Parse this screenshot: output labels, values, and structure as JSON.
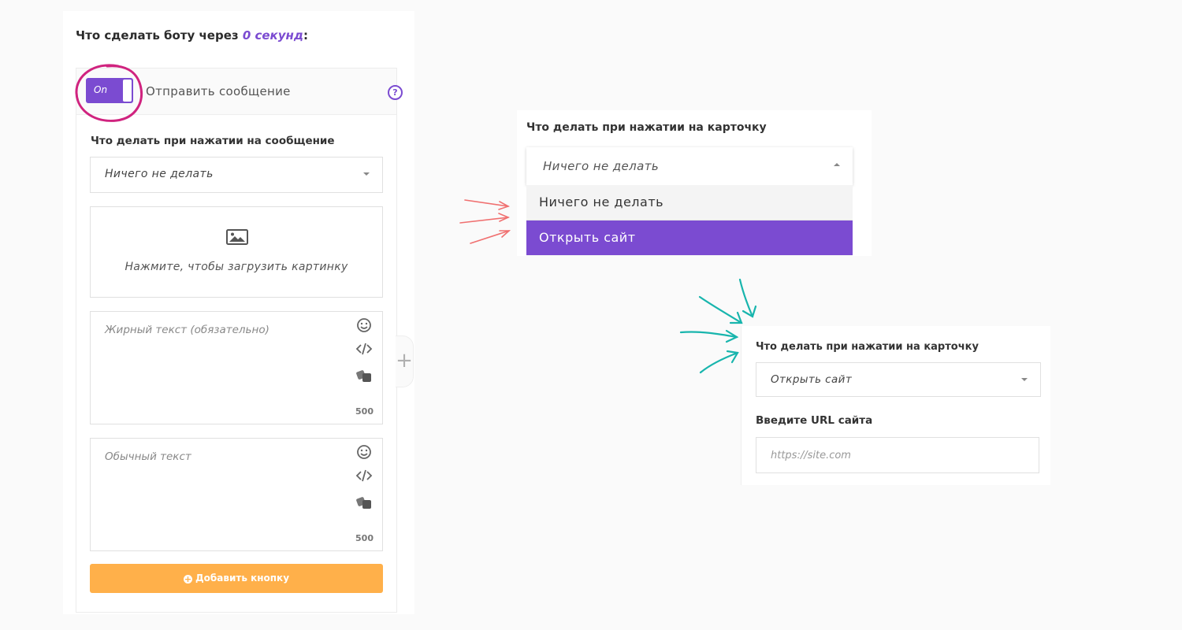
{
  "left_panel": {
    "title_prefix": "Что сделать боту через ",
    "title_delay": "0 секунд",
    "title_suffix": ":",
    "message_card": {
      "toggle_label": "On",
      "title": "Отправить сообщение",
      "help_icon": "?",
      "on_click_label": "Что делать при нажатии на сообщение",
      "on_click_value": "Ничего не делать",
      "upload_text": "Нажмите, чтобы загрузить картинку",
      "bold_text_placeholder": "Жирный текст (обязательно)",
      "bold_text_count": "500",
      "plain_text_placeholder": "Обычный текст",
      "plain_text_count": "500",
      "add_button_label": "Добавить кнопку"
    },
    "add_block_icon": "+"
  },
  "dropdown_demo": {
    "label": "Что делать при нажатии на карточку",
    "selected": "Ничего не делать",
    "options": [
      "Ничего не делать",
      "Открыть сайт"
    ],
    "highlighted_index": 1
  },
  "result_demo": {
    "label": "Что делать при нажатии на карточку",
    "selected": "Открыть сайт",
    "url_label": "Введите URL сайта",
    "url_placeholder": "https://site.com"
  },
  "colors": {
    "accent": "#7b4bd1",
    "button": "#ffb04a",
    "annotation_circle": "#d0237f",
    "annotation_red_arrows": "#f07070",
    "annotation_teal_arrows": "#18b5ad"
  }
}
